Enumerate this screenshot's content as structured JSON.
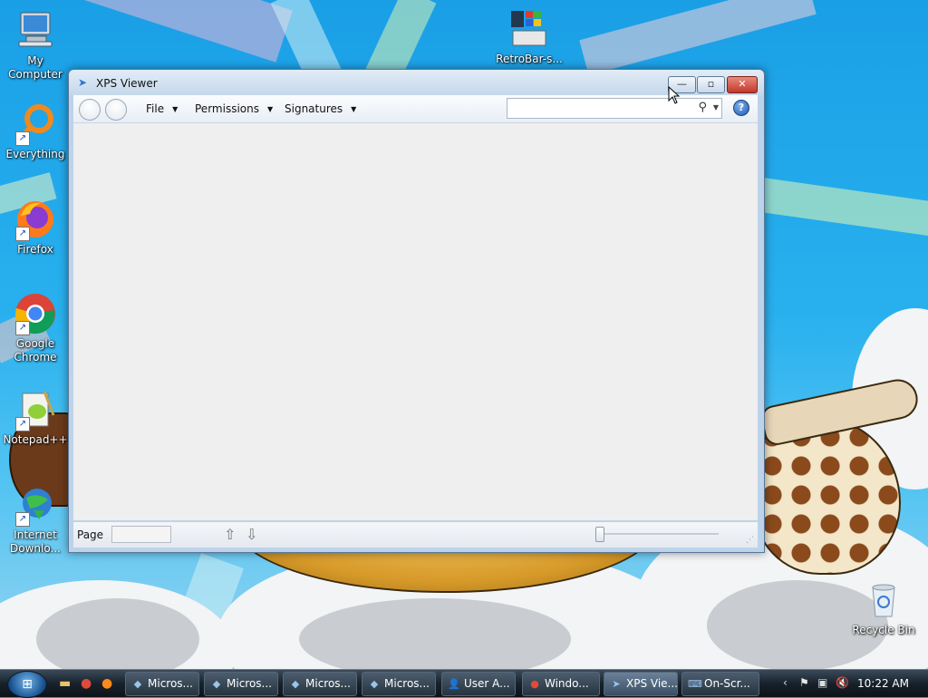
{
  "desktop": {
    "icons": [
      {
        "label": "My Computer",
        "icon": "computer-icon"
      },
      {
        "label": "Everything",
        "icon": "everything-icon"
      },
      {
        "label": "Firefox",
        "icon": "firefox-icon"
      },
      {
        "label": "Google Chrome",
        "icon": "chrome-icon"
      },
      {
        "label": "Notepad++",
        "icon": "notepadpp-icon"
      },
      {
        "label": "Internet Downlo...",
        "icon": "idm-icon"
      },
      {
        "label": "RetroBar-s...",
        "icon": "retrobar-icon"
      },
      {
        "label": "Recycle Bin",
        "icon": "recycle-bin-icon"
      }
    ]
  },
  "window": {
    "title": "XPS Viewer",
    "controls": {
      "minimize": "—",
      "maximize": "▫",
      "close": "✕"
    },
    "menus": [
      "File",
      "Permissions",
      "Signatures"
    ],
    "search": {
      "placeholder": ""
    },
    "help": "?",
    "status": {
      "page_label": "Page",
      "page_value": "",
      "up": "⇧",
      "down": "⇩"
    }
  },
  "taskbar": {
    "start_label": "Start",
    "items": [
      {
        "label": "Micros...",
        "icon": "ms-app-icon"
      },
      {
        "label": "Micros...",
        "icon": "ms-app-icon"
      },
      {
        "label": "Micros...",
        "icon": "ms-app-icon"
      },
      {
        "label": "Micros...",
        "icon": "ms-app-icon"
      },
      {
        "label": "User A...",
        "icon": "user-accounts-icon"
      },
      {
        "label": "Windo...",
        "icon": "chrome-icon"
      },
      {
        "label": "XPS Vie...",
        "icon": "xps-viewer-icon"
      },
      {
        "label": "On-Scr...",
        "icon": "keyboard-icon"
      }
    ],
    "clock": "10:22 AM"
  },
  "colors": {
    "desktop_sky": "#28b0ee",
    "window_frame": "#bcd3ea",
    "close_red": "#c0382b",
    "taskbar": "#18222c"
  }
}
